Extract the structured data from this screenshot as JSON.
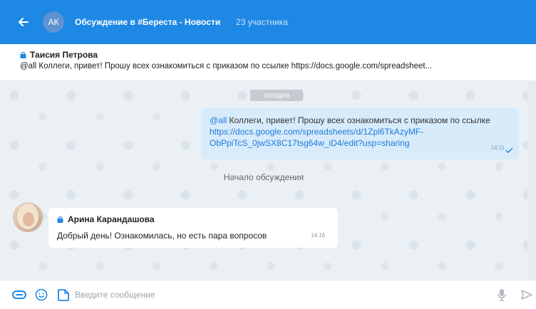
{
  "header": {
    "avatar_initials": "АК",
    "title": "Обсуждение в #Береста - Новости",
    "participants": "23 участника",
    "color": "#1e88e5"
  },
  "pinned": {
    "author": "Таисия Петрова",
    "text": "@all Коллеги, привет! Прошу всех ознакомиться с приказом по ссылке https://docs.google.com/spreadsheet..."
  },
  "chat": {
    "date_chip": "сегодня",
    "outgoing": {
      "mention": "@all",
      "text": " Коллеги, привет! Прошу всех ознакомиться с приказом по ссылке ",
      "link": "https://docs.google.com/spreadsheets/d/1Zpl6TkAzyMF-ObPpiTcS_0jwSX8C17tsg64w_iD4/edit?usp=sharing",
      "time": "14:11"
    },
    "system": "Начало обсуждения",
    "incoming": {
      "author": "Арина Карандашова",
      "text": "Добрый день! Ознакомилась, но есть пара вопросов",
      "time": "14:16"
    }
  },
  "composer": {
    "placeholder": "Введите сообщение"
  }
}
